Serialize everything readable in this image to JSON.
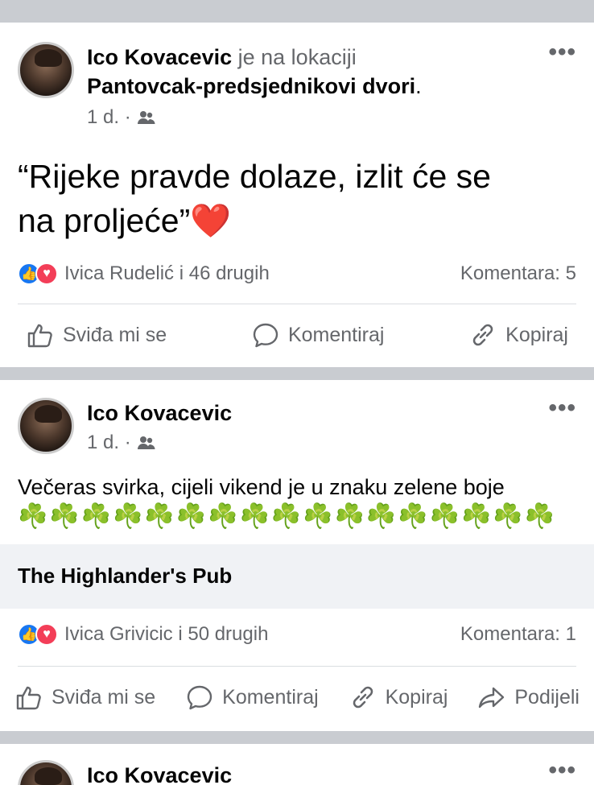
{
  "post1": {
    "author": "Ico Kovacevic",
    "location_prefix": "je na lokaciji",
    "location": "Pantovcak-predsjednikovi dvori",
    "location_suffix": ".",
    "time": "1 d. ·",
    "text_line1": "“Rijeke pravde dolaze, izlit će se",
    "text_line2": "na proljeće”",
    "heart": "❤️",
    "reactions_text": "Ivica Rudelić i 46 drugih",
    "comments": "Komentara: 5",
    "actions": {
      "like": "Sviđa mi se",
      "comment": "Komentiraj",
      "copy": "Kopiraj"
    },
    "more": "•••"
  },
  "post2": {
    "author": "Ico Kovacevic",
    "time": "1 d. ·",
    "text": "Večeras svirka, cijeli vikend je u znaku zelene boje",
    "clovers": "☘️☘️☘️☘️☘️☘️☘️☘️☘️☘️☘️☘️☘️☘️☘️☘️☘️",
    "link_title": "The Highlander's Pub",
    "reactions_text": "Ivica Grivicic i 50 drugih",
    "comments": "Komentara: 1",
    "actions": {
      "like": "Sviđa mi se",
      "comment": "Komentiraj",
      "copy": "Kopiraj",
      "share": "Podijeli"
    },
    "more": "•••"
  },
  "post3": {
    "author": "Ico Kovacevic",
    "more": "•••"
  },
  "colors": {
    "like_blue": "#1877f2",
    "love_red": "#f33e58",
    "separator": "#c9ccd1",
    "clover_green": "#2e9e3a"
  }
}
